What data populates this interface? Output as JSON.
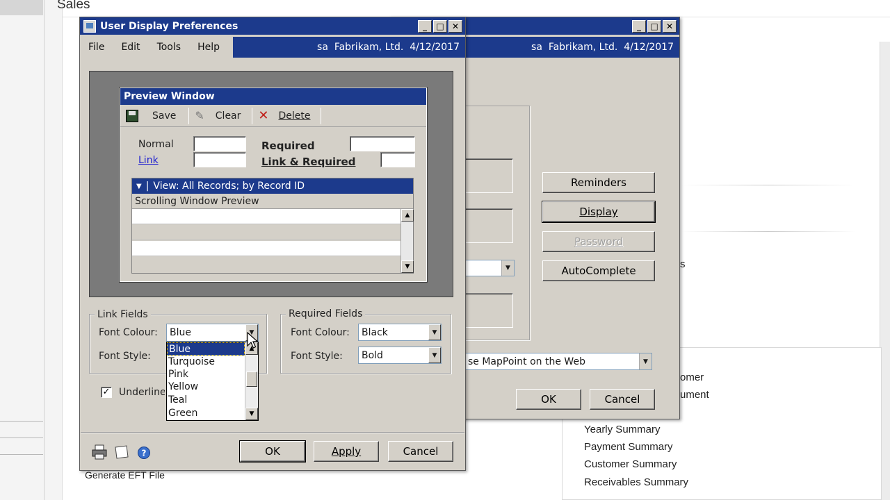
{
  "background": {
    "title": "Sales",
    "items": [
      "omer",
      "ument",
      "Yearly Summary",
      "Payment Summary",
      "Customer Summary",
      "Receivables Summary"
    ],
    "stray_s": "s",
    "bottom_left": "Generate EFT File"
  },
  "back_dialog": {
    "info": "sa  Fabrikam, Ltd.  4/12/2017",
    "buttons": {
      "reminders": "Reminders",
      "display": "Display",
      "password": "Password",
      "autocomplete": "AutoComplete",
      "ok": "OK",
      "cancel": "Cancel"
    },
    "mappoint": "se MapPoint on the Web"
  },
  "dialog": {
    "title": "User Display Preferences",
    "menu": [
      "File",
      "Edit",
      "Tools",
      "Help"
    ],
    "info": "sa  Fabrikam, Ltd.  4/12/2017",
    "preview": {
      "title": "Preview Window",
      "toolbar": {
        "save": "Save",
        "clear": "Clear",
        "delete": "Delete"
      },
      "normal": "Normal",
      "link": "Link",
      "required": "Required",
      "link_required": "Link & Required",
      "view_header": "View: All Records; by Record ID",
      "scroll_label": "Scrolling Window Preview"
    },
    "link_fields": {
      "legend": "Link Fields",
      "font_colour_label": "Font Colour:",
      "font_colour_value": "Blue",
      "font_style_label": "Font Style:",
      "dropdown_options": [
        "Blue",
        "Turquoise",
        "Pink",
        "Yellow",
        "Teal",
        "Green"
      ],
      "dropdown_selected": "Blue"
    },
    "required_fields": {
      "legend": "Required Fields",
      "font_colour_label": "Font Colour:",
      "font_colour_value": "Black",
      "font_style_label": "Font Style:",
      "font_style_value": "Bold"
    },
    "underline_label": "Underline L",
    "buttons": {
      "ok": "OK",
      "apply": "Apply",
      "cancel": "Cancel"
    }
  },
  "colors": {
    "title_blue": "#1c3a8c",
    "dialog_gray": "#d4d0c8",
    "link_blue": "#2020d0"
  }
}
